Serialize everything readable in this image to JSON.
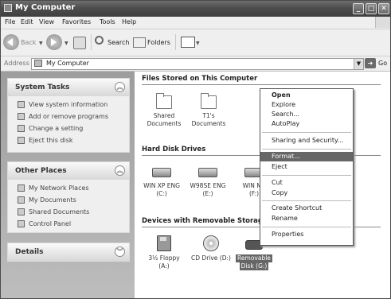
{
  "window": {
    "title": "My Computer"
  },
  "menu": [
    "File",
    "Edit",
    "View",
    "Favorites",
    "Tools",
    "Help"
  ],
  "toolbar": {
    "back": "Back",
    "search": "Search",
    "folders": "Folders"
  },
  "address": {
    "label": "Address",
    "value": "My Computer",
    "go": "Go"
  },
  "left": {
    "system_tasks": {
      "title": "System Tasks",
      "items": [
        "View system information",
        "Add or remove programs",
        "Change a setting",
        "Eject this disk"
      ]
    },
    "other_places": {
      "title": "Other Places",
      "items": [
        "My Network Places",
        "My Documents",
        "Shared Documents",
        "Control Panel"
      ]
    },
    "details": {
      "title": "Details"
    }
  },
  "groups": {
    "stored": {
      "title": "Files Stored on This Computer",
      "items": [
        {
          "line1": "Shared",
          "line2": "Documents"
        },
        {
          "line1": "T1's",
          "line2": "Documents"
        }
      ]
    },
    "hdd": {
      "title": "Hard Disk Drives",
      "items": [
        {
          "line1": "WIN XP ENG",
          "line2": "(C:)"
        },
        {
          "line1": "W98SE ENG",
          "line2": "(E:)"
        },
        {
          "line1": "WIN ME",
          "line2": "(F:)"
        }
      ]
    },
    "removable": {
      "title": "Devices with Removable Storage",
      "items": [
        {
          "line1": "3½ Floppy",
          "line2": "(A:)"
        },
        {
          "line1": "CD Drive (D:)",
          "line2": ""
        },
        {
          "line1": "Removable",
          "line2": "Disk (G:)"
        }
      ]
    }
  },
  "context_menu": [
    "Open",
    "Explore",
    "Search...",
    "AutoPlay",
    "Sharing and Security...",
    "Format...",
    "Eject",
    "Cut",
    "Copy",
    "Create Shortcut",
    "Rename",
    "Properties"
  ]
}
